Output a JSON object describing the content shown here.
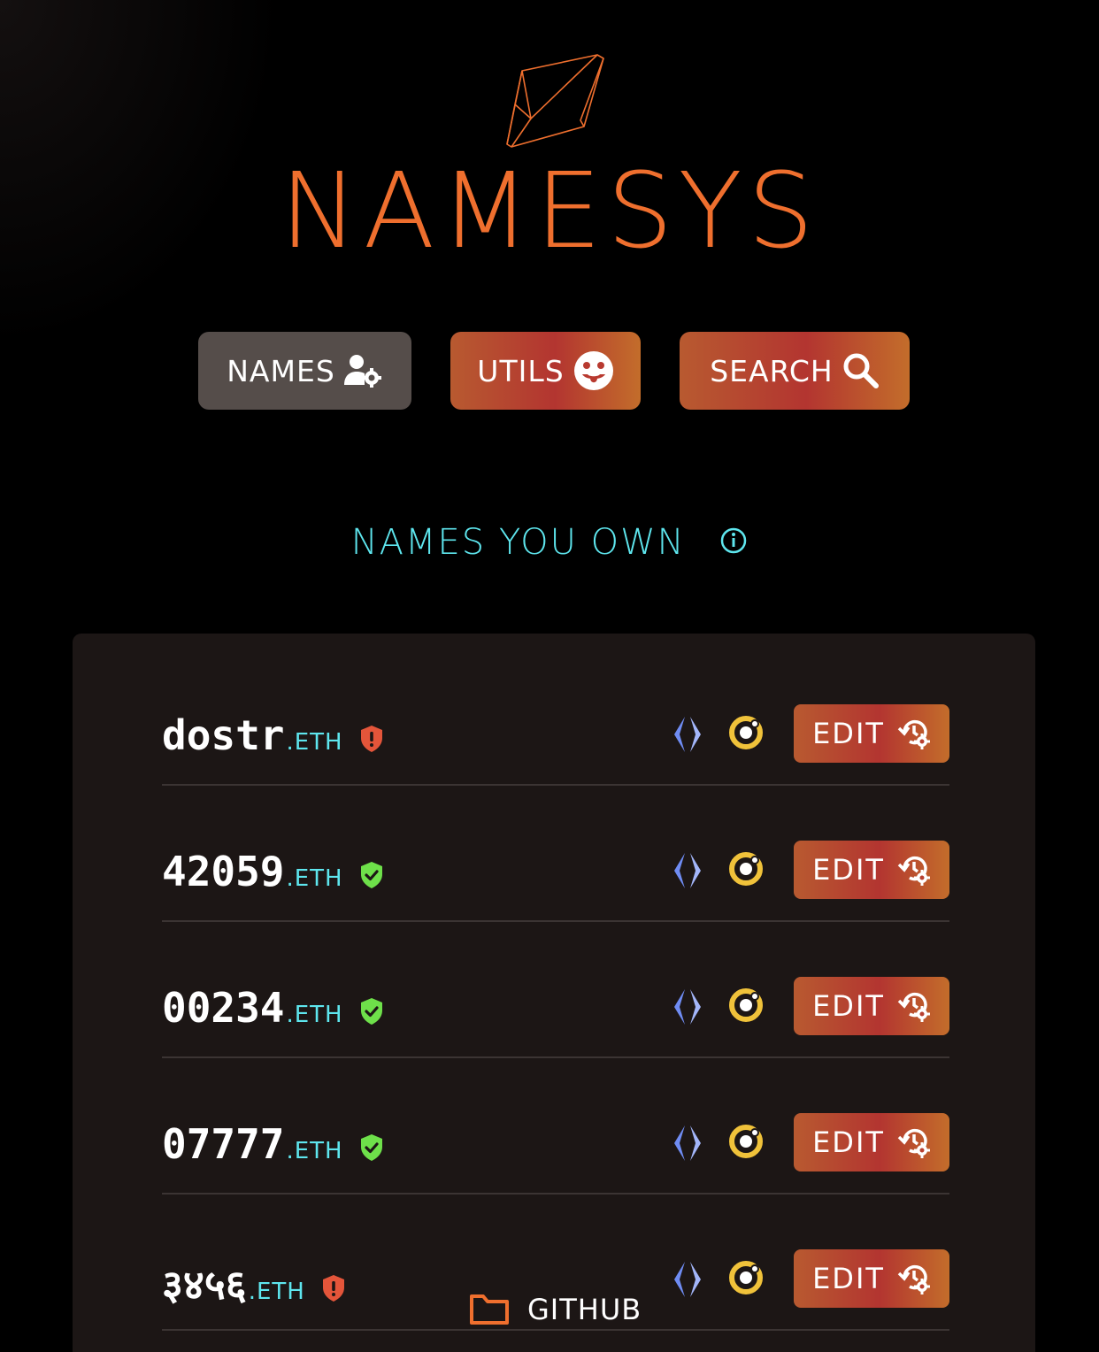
{
  "brand": {
    "name": "NAMESYS",
    "color": "#ef6f2e"
  },
  "nav": {
    "names_label": "NAMES",
    "utils_label": "UTILS",
    "search_label": "SEARCH"
  },
  "section": {
    "title": "NAMES YOU OWN"
  },
  "names": [
    {
      "label": "dostr",
      "tld": ".ETH",
      "status": "warning",
      "edit_label": "EDIT"
    },
    {
      "label": "42059",
      "tld": ".ETH",
      "status": "verified",
      "edit_label": "EDIT"
    },
    {
      "label": "00234",
      "tld": ".ETH",
      "status": "verified",
      "edit_label": "EDIT"
    },
    {
      "label": "07777",
      "tld": ".ETH",
      "status": "verified",
      "edit_label": "EDIT"
    },
    {
      "label": "३४५६",
      "tld": ".ETH",
      "status": "warning",
      "edit_label": "EDIT"
    }
  ],
  "footer": {
    "github_label": "GITHUB"
  },
  "colors": {
    "accent_orange": "#ef6f2e",
    "cyan": "#5ee6ee",
    "verified_green": "#6ee04a",
    "warning_red": "#e4553a",
    "ens_blue": "#6f8cf3",
    "ipfs_yellow": "#f0c23a"
  },
  "icons": {
    "names": "user-gear-icon",
    "utils": "smiley-icon",
    "search": "search-icon",
    "info": "info-icon",
    "edit": "history-gear-icon",
    "ens": "ens-icon",
    "ipfs": "ipfs-icon",
    "github": "folder-icon"
  }
}
